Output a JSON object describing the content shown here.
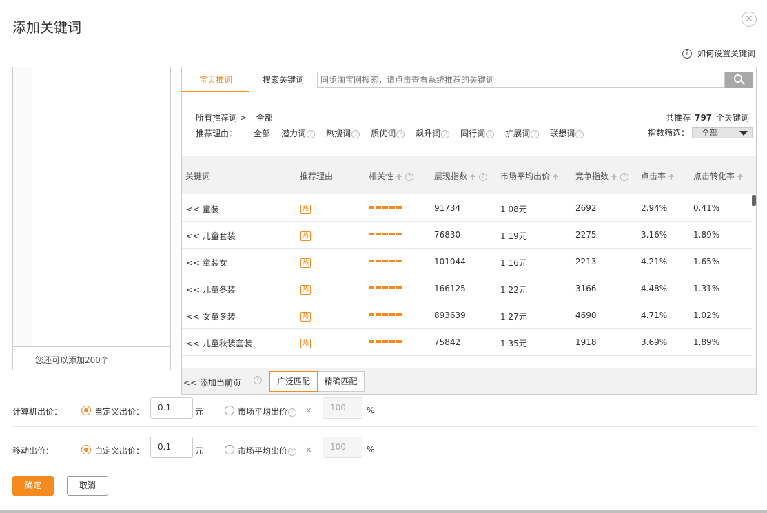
{
  "dialog": {
    "title": "添加关键词",
    "close_icon": "close-icon",
    "help_text": "如何设置关键词",
    "help_icon": "question-circle-icon"
  },
  "left_panel": {
    "footer_text": "您还可以添加200个"
  },
  "tabs": [
    {
      "label": "宝贝推词",
      "active": true
    },
    {
      "label": "搜索关键词",
      "active": false
    }
  ],
  "search": {
    "placeholder": "同步淘宝网搜索，请点击查看系统推荐的关键词",
    "icon": "search-icon"
  },
  "filters": {
    "crumb_label": "所有推荐词 >",
    "crumb_value": "全部",
    "reason_label": "推荐理由：",
    "reasons": [
      "全部",
      "潜力词",
      "热搜词",
      "质优词",
      "飙升词",
      "同行词",
      "扩展词",
      "联想词"
    ],
    "total_prefix": "共推荐",
    "total_count": "797",
    "total_suffix": "个关键词",
    "index_filter_label": "指数筛选：",
    "index_filter_value": "全部"
  },
  "table": {
    "columns": [
      "关键词",
      "推荐理由",
      "相关性",
      "展现指数",
      "市场平均出价",
      "竞争指数",
      "点击率",
      "点击转化率"
    ],
    "rows": [
      {
        "keyword": "<< 童装",
        "reason": "热",
        "relevance": 5,
        "impressions": "91734",
        "avg_bid": "1.08元",
        "competition": "2692",
        "ctr": "2.94%",
        "cvr": "0.41%"
      },
      {
        "keyword": "<< 儿童套装",
        "reason": "热",
        "relevance": 5,
        "impressions": "76830",
        "avg_bid": "1.19元",
        "competition": "2275",
        "ctr": "3.16%",
        "cvr": "1.89%"
      },
      {
        "keyword": "<< 童装女",
        "reason": "热",
        "relevance": 5,
        "impressions": "101044",
        "avg_bid": "1.16元",
        "competition": "2213",
        "ctr": "4.21%",
        "cvr": "1.65%"
      },
      {
        "keyword": "<< 儿童冬装",
        "reason": "热",
        "relevance": 5,
        "impressions": "166125",
        "avg_bid": "1.22元",
        "competition": "3166",
        "ctr": "4.48%",
        "cvr": "1.31%"
      },
      {
        "keyword": "<< 女童冬装",
        "reason": "热",
        "relevance": 5,
        "impressions": "893639",
        "avg_bid": "1.27元",
        "competition": "4690",
        "ctr": "4.71%",
        "cvr": "1.02%"
      },
      {
        "keyword": "<< 儿童秋装套装",
        "reason": "热",
        "relevance": 5,
        "impressions": "75842",
        "avg_bid": "1.35元",
        "competition": "1918",
        "ctr": "3.69%",
        "cvr": "1.89%"
      }
    ],
    "footer": {
      "add_page": "<< 添加当前页",
      "broad_match": "广泛匹配",
      "exact_match": "精确匹配"
    }
  },
  "bids": {
    "pc": {
      "label": "计算机出价：",
      "custom_label": "自定义出价：",
      "value": "0.1",
      "unit": "元",
      "market_label": "市场平均出价",
      "times": "×",
      "percent_value": "100",
      "percent_unit": "%"
    },
    "mobile": {
      "label": "移动出价：",
      "custom_label": "自定义出价：",
      "value": "0.1",
      "unit": "元",
      "market_label": "市场平均出价",
      "times": "×",
      "percent_value": "100",
      "percent_unit": "%"
    }
  },
  "buttons": {
    "ok": "确定",
    "cancel": "取消"
  },
  "colors": {
    "accent": "#f58a1f"
  }
}
